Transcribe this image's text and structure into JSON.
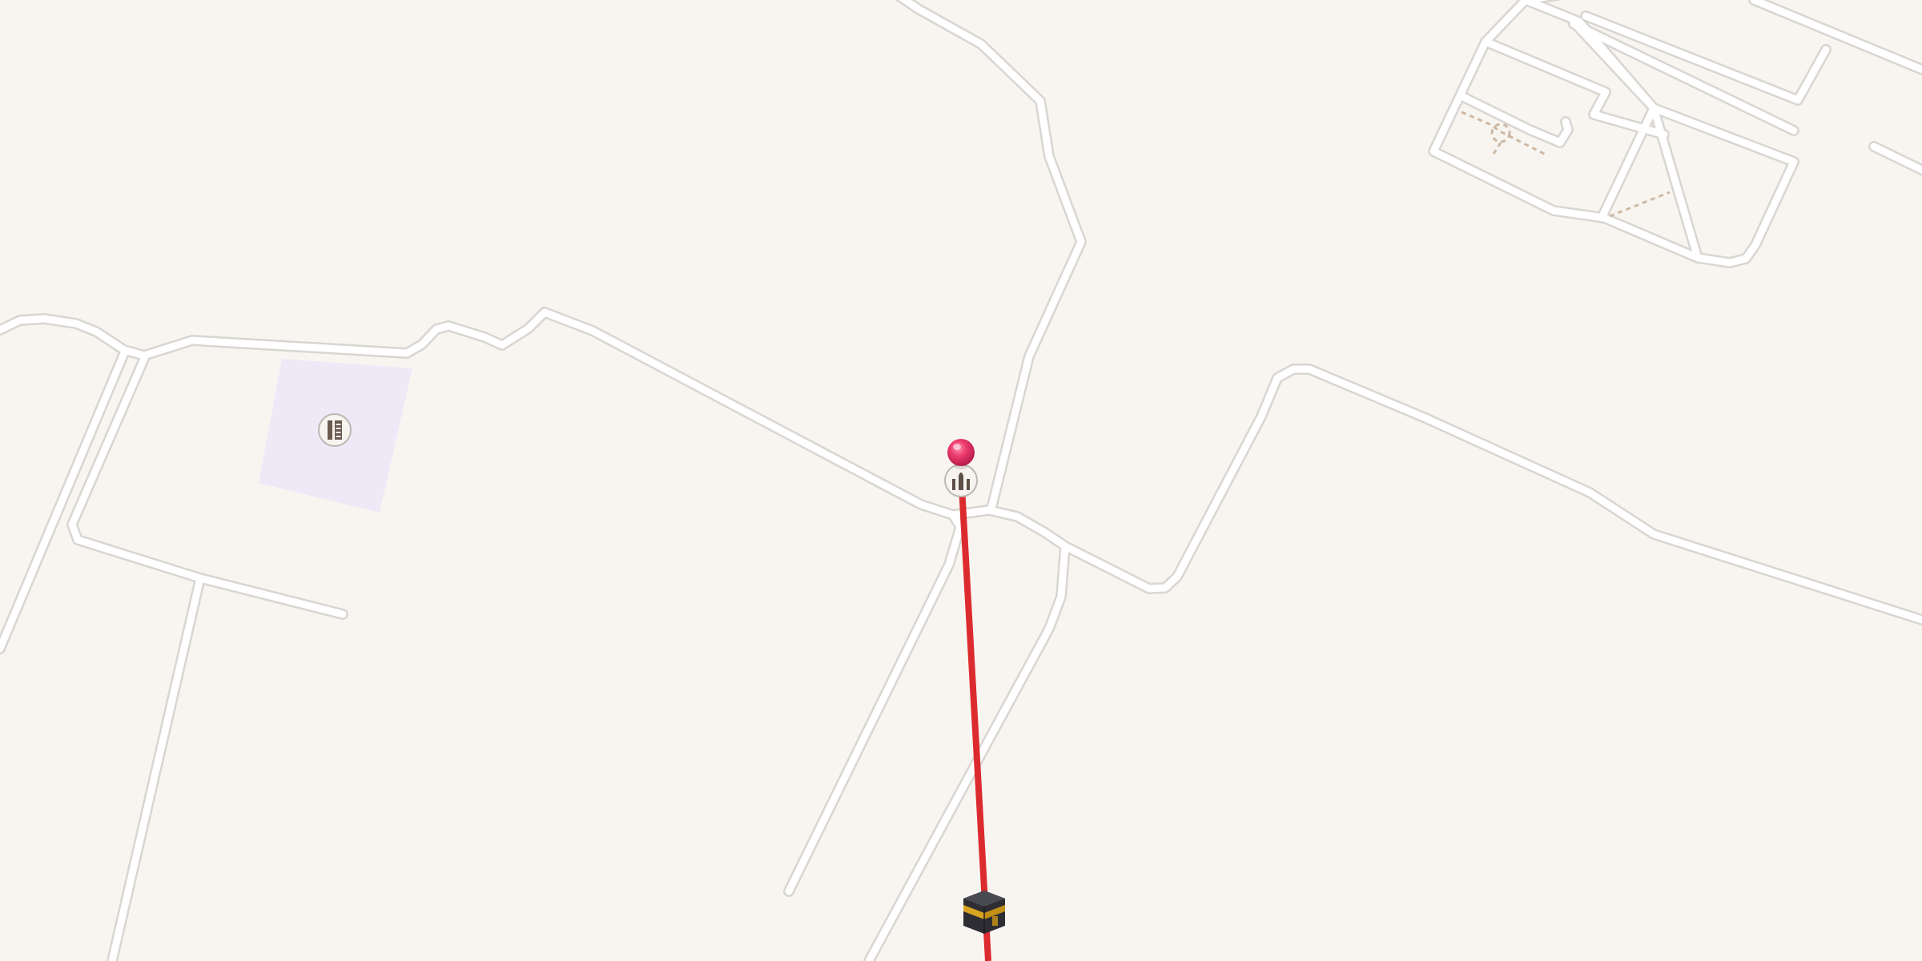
{
  "map": {
    "background_color": "#f8f5f1",
    "road_color": "#ffffff",
    "road_casing_color": "#d9d5d1",
    "poi_area_color": "#efe8f7",
    "footpath_color": "#cdb9a5",
    "qibla_line_color": "#dc2b2f",
    "pin_color": "#ec3b6c"
  },
  "markers": {
    "location_pin": {
      "icon": "red-location-pin-icon",
      "interactable": true
    },
    "mosque_poi": {
      "icon": "mosque-icon"
    },
    "school_poi": {
      "icon": "school-building-icon"
    },
    "kaaba": {
      "icon": "kaaba-icon"
    }
  },
  "qibla_line": {
    "icon": "qibla-direction-line"
  }
}
